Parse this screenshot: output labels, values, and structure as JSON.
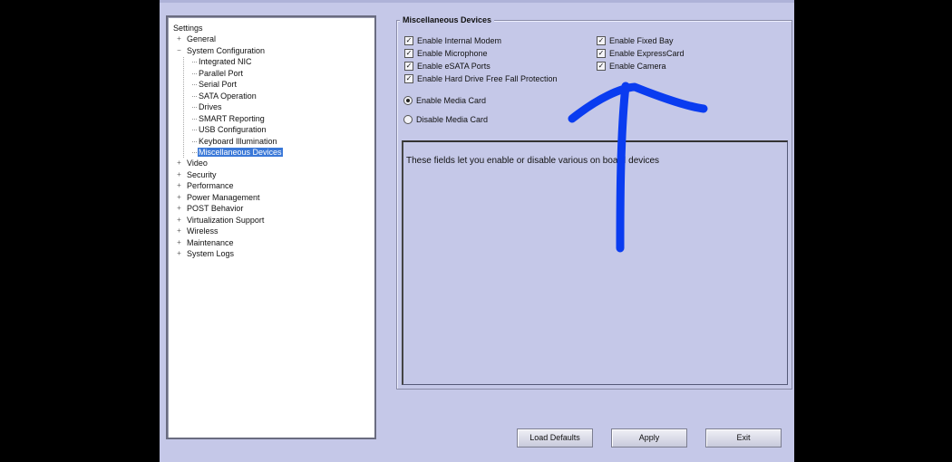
{
  "tree": {
    "items": [
      {
        "label": "Settings",
        "level": 0,
        "expander": ""
      },
      {
        "label": "General",
        "level": 1,
        "expander": "+"
      },
      {
        "label": "System Configuration",
        "level": 1,
        "expander": "−"
      },
      {
        "label": "Integrated NIC",
        "level": 2,
        "expander": ""
      },
      {
        "label": "Parallel Port",
        "level": 2,
        "expander": ""
      },
      {
        "label": "Serial Port",
        "level": 2,
        "expander": ""
      },
      {
        "label": "SATA Operation",
        "level": 2,
        "expander": ""
      },
      {
        "label": "Drives",
        "level": 2,
        "expander": ""
      },
      {
        "label": "SMART Reporting",
        "level": 2,
        "expander": ""
      },
      {
        "label": "USB Configuration",
        "level": 2,
        "expander": ""
      },
      {
        "label": "Keyboard Illumination",
        "level": 2,
        "expander": ""
      },
      {
        "label": "Miscellaneous Devices",
        "level": 2,
        "expander": "",
        "selected": true
      },
      {
        "label": "Video",
        "level": 1,
        "expander": "+"
      },
      {
        "label": "Security",
        "level": 1,
        "expander": "+"
      },
      {
        "label": "Performance",
        "level": 1,
        "expander": "+"
      },
      {
        "label": "Power Management",
        "level": 1,
        "expander": "+"
      },
      {
        "label": "POST Behavior",
        "level": 1,
        "expander": "+"
      },
      {
        "label": "Virtualization Support",
        "level": 1,
        "expander": "+"
      },
      {
        "label": "Wireless",
        "level": 1,
        "expander": "+"
      },
      {
        "label": "Maintenance",
        "level": 1,
        "expander": "+"
      },
      {
        "label": "System Logs",
        "level": 1,
        "expander": "+"
      }
    ]
  },
  "group": {
    "title": "Miscellaneous Devices",
    "left_checkboxes": [
      {
        "label": "Enable Internal Modem",
        "checked": true
      },
      {
        "label": "Enable Microphone",
        "checked": true
      },
      {
        "label": "Enable eSATA Ports",
        "checked": true
      },
      {
        "label": "Enable Hard Drive Free Fall Protection",
        "checked": true
      }
    ],
    "right_checkboxes": [
      {
        "label": "Enable Fixed Bay",
        "checked": true
      },
      {
        "label": "Enable ExpressCard",
        "checked": true
      },
      {
        "label": "Enable Camera",
        "checked": true
      }
    ],
    "radios": [
      {
        "label": "Enable Media Card",
        "selected": true
      },
      {
        "label": "Disable Media Card",
        "selected": false
      }
    ],
    "description": "These fields let you enable or disable various on board devices"
  },
  "buttons": {
    "load_defaults": "Load Defaults",
    "apply": "Apply",
    "exit": "Exit"
  },
  "annotation": {
    "color": "#0a3cf0",
    "kind": "hand-drawn-arrow",
    "points_to": "Enable Camera"
  }
}
